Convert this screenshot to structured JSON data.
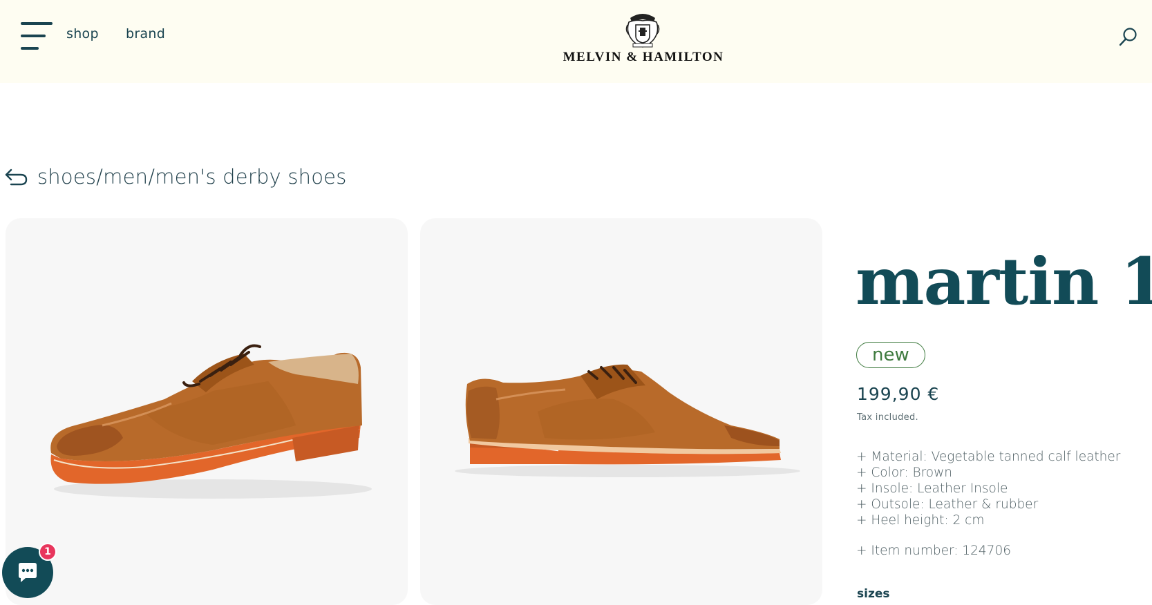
{
  "header": {
    "nav": [
      {
        "label": "shop"
      },
      {
        "label": "brand"
      }
    ],
    "logo_text": "MELVIN & HAMILTON",
    "icons": {
      "menu": "menu-icon",
      "search": "search-icon",
      "crest": "crest-logo-icon"
    }
  },
  "breadcrumb": {
    "text": "shoes/men/men's derby shoes",
    "icon": "back-arrow-icon"
  },
  "product": {
    "title": "martin 1",
    "badge": "new",
    "price": "199,90 €",
    "tax_note": "Tax included.",
    "specs": [
      "+ Material: Vegetable tanned calf leather",
      "+ Color: Brown",
      "+ Insole: Leather Insole",
      "+ Outsole: Leather & rubber",
      "+ Heel height: 2 cm"
    ],
    "item_number": "+ Item number: 124706",
    "sizes_label": "sizes",
    "images": [
      {
        "alt": "front three-quarter view of brown derby shoe"
      },
      {
        "alt": "side view of brown derby shoe"
      }
    ]
  },
  "chat": {
    "badge_count": "1",
    "icon": "chat-icon"
  },
  "colors": {
    "header_bg": "#fefdf2",
    "title": "#124b57",
    "badge": "#3e7a3e",
    "chat_bg": "#124b57",
    "notification": "#e8365d",
    "shoe_leather": "#b86a2a",
    "sole": "#e2662a"
  }
}
